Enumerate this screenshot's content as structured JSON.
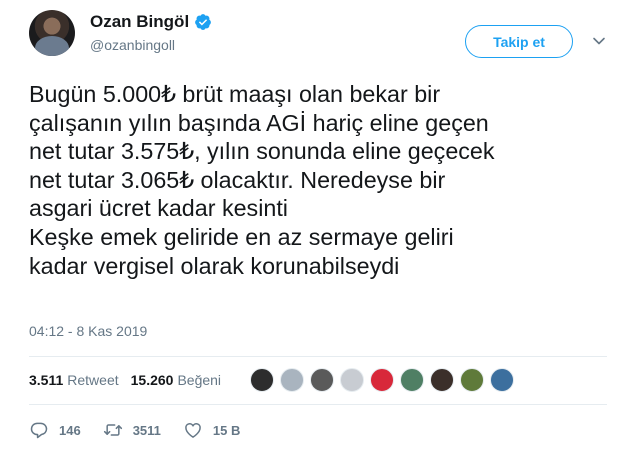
{
  "author": {
    "name": "Ozan Bingöl",
    "handle": "@ozanbingoll",
    "verified": true
  },
  "follow_button": "Takip et",
  "tweet": {
    "text": "Bugün 5.000₺ brüt maaşı olan bekar bir\nçalışanın yılın başında AGİ hariç eline geçen\nnet tutar 3.575₺, yılın sonunda eline geçecek\nnet tutar 3.065₺ olacaktır. Neredeyse bir\nasgari ücret kadar kesinti\nKeşke emek geliride en az sermaye geliri\nkadar vergisel olarak korunabilseydi",
    "timestamp": "04:12 - 8 Kas 2019"
  },
  "stats": {
    "retweets_count": "3.511",
    "retweets_label": "Retweet",
    "likes_count": "15.260",
    "likes_label": "Beğeni"
  },
  "likers": [
    {
      "color": "#2d2d2d"
    },
    {
      "color": "#a9b4bf"
    },
    {
      "color": "#5a5a5a"
    },
    {
      "color": "#c8ccd2"
    },
    {
      "color": "#d8283a"
    },
    {
      "color": "#4f7f64"
    },
    {
      "color": "#3b2f2a"
    },
    {
      "color": "#5f7a3a"
    },
    {
      "color": "#3c6f9e"
    }
  ],
  "actions": {
    "reply_count": "146",
    "retweet_count": "3511",
    "like_count": "15 B"
  },
  "colors": {
    "accent": "#1da1f2",
    "text": "#14171a",
    "secondary": "#657786"
  }
}
